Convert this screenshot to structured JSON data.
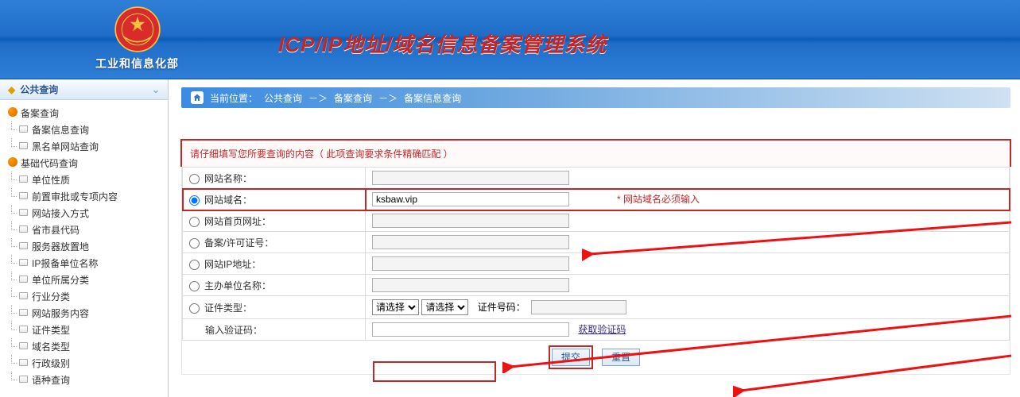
{
  "header": {
    "ministry": "工业和信息化部",
    "system_title": "ICP/IP地址/域名信息备案管理系统"
  },
  "sidebar": {
    "nav_title": "公共查询",
    "groups": [
      {
        "label": "备案查询",
        "items": [
          "备案信息查询",
          "黑名单网站查询"
        ]
      },
      {
        "label": "基础代码查询",
        "items": [
          "单位性质",
          "前置审批或专项内容",
          "网站接入方式",
          "省市县代码",
          "服务器放置地",
          "IP报备单位名称",
          "单位所属分类",
          "行业分类",
          "网站服务内容",
          "证件类型",
          "域名类型",
          "行政级别",
          "语种查询"
        ]
      }
    ]
  },
  "breadcrumb": {
    "here": "当前位置：",
    "l1": "公共查询",
    "sep": "－＞",
    "l2": "备案查询",
    "l3": "备案信息查询"
  },
  "form": {
    "hint": "请仔细填写您所要查询的内容（ 此项查询要求条件精确匹配 ）",
    "rows": {
      "site_name": "网站名称：",
      "domain": "网站域名：",
      "homepage": "网站首页网址：",
      "license": "备案/许可证号：",
      "ip": "网站IP地址：",
      "sponsor": "主办单位名称：",
      "cert_type": "证件类型：",
      "captcha": "输入验证码："
    },
    "domain_value": "ksbaw.vip",
    "select_placeholder": "请选择",
    "cert_no_label": "证件号码：",
    "captcha_link": "获取验证码",
    "side_note": "* 网站域名必须输入",
    "submit": "提交",
    "reset": "重置"
  }
}
